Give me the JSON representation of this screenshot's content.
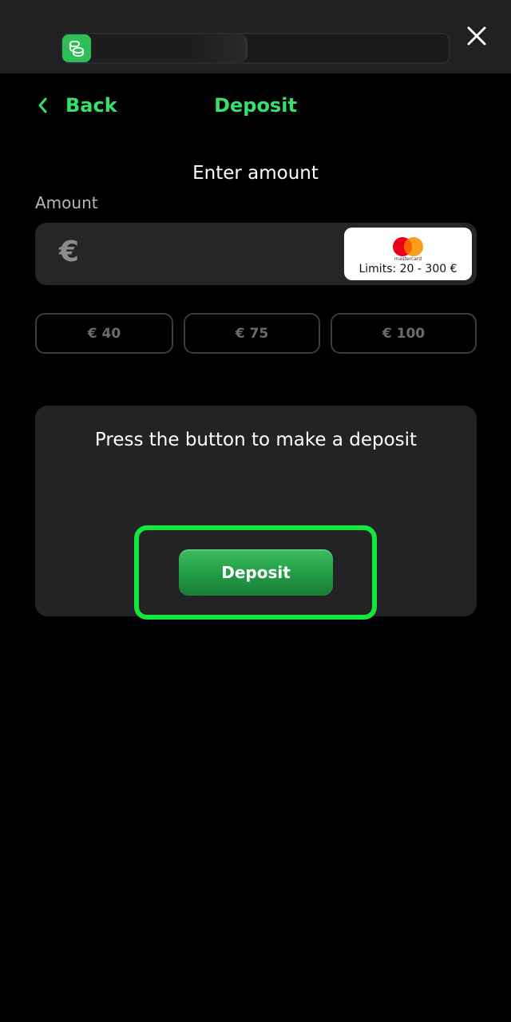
{
  "header": {
    "progress_percent": 48,
    "step_icon": "coins-icon",
    "close_icon": "close-icon"
  },
  "nav": {
    "back_label": "Back",
    "title": "Deposit"
  },
  "form": {
    "heading": "Enter amount",
    "amount_label": "Amount",
    "currency_symbol": "€",
    "amount_value": "",
    "card_brand_text": "mastercard",
    "limits": "Limits: 20 - 300 €",
    "presets": [
      "€ 40",
      "€ 75",
      "€ 100"
    ]
  },
  "panel": {
    "message": "Press the button to make a deposit",
    "button_label": "Deposit"
  },
  "colors": {
    "accent": "#37e06b",
    "highlight": "#15e63a",
    "button": "#229a45"
  }
}
